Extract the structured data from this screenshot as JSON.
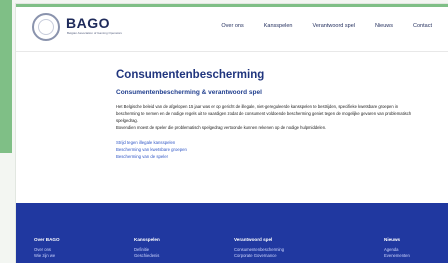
{
  "logo": {
    "name": "BAGO",
    "subtitle": "Belgian Association of Gaming Operators"
  },
  "nav": {
    "items": [
      "Over ons",
      "Kansspelen",
      "Verantwoord spel",
      "Nieuws",
      "Contact"
    ]
  },
  "main": {
    "title": "Consumentenbescherming",
    "subtitle": "Consumentenbescherming & verantwoord spel",
    "paragraph1": "Het Belgische beleid van de afgelopen 15 jaar was er op gericht de illegale, niet-gereguleerde kansspelen te bestrijden, specifieke kwetsbare groepen in bescherming te nemen en de nodige regels uit te vaardigen zodat de consument voldoende bescherming geniet tegen de mogelijke gevaren van problematisch spelgedrag.",
    "paragraph2": "Bovendien moest de speler die problematisch spelgedrag vertoonde kunnen rekenen op de nodige hulpmiddelen.",
    "links": [
      "Strijd tegen illegale kansspelen",
      "Bescherming van kwetsbare groepen",
      "Bescherming van de speler"
    ]
  },
  "footer": {
    "columns": [
      {
        "heading": "Over BAGO",
        "links": [
          "Over ons",
          "Wie zijn we"
        ]
      },
      {
        "heading": "Kansspelen",
        "links": [
          "Definitie",
          "Geschiedenis"
        ]
      },
      {
        "heading": "Verantwoord spel",
        "links": [
          "Consumentenbescherming",
          "Corporate Governance"
        ]
      },
      {
        "heading": "Nieuws",
        "links": [
          "Agenda",
          "Evenementen"
        ]
      }
    ]
  },
  "colors": {
    "accent": "#7fbf86",
    "brand_blue": "#2038a0",
    "title_blue": "#20357e",
    "link_blue": "#2f56c6"
  }
}
